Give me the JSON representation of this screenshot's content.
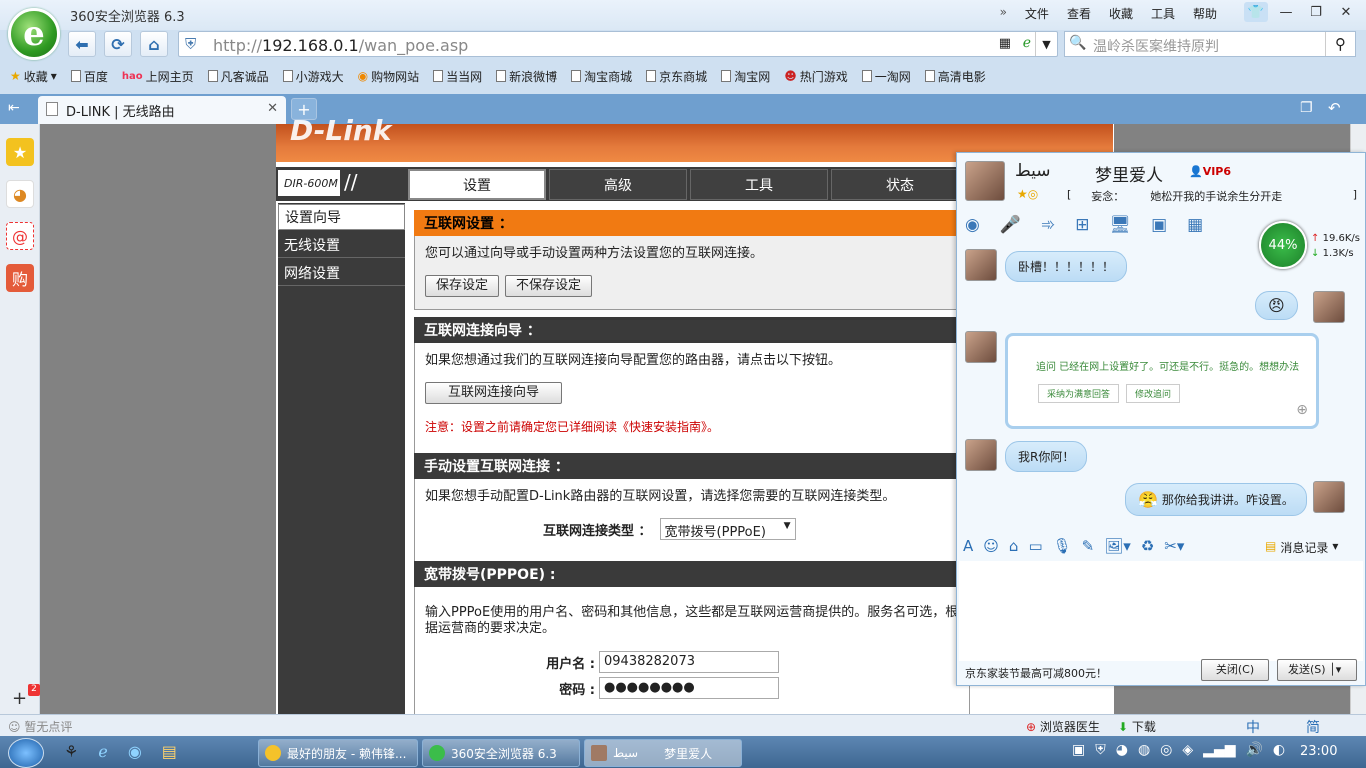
{
  "browser": {
    "title": "360安全浏览器 6.3",
    "menu": [
      "文件",
      "查看",
      "收藏",
      "工具",
      "帮助"
    ],
    "url_prefix": "http://",
    "url_host": "192.168.0.1",
    "url_path": "/wan_poe.asp",
    "search_placeholder": "温岭杀医案维持原判",
    "favorites_label": "收藏",
    "bookmarks": [
      "百度",
      "上网主页",
      "凡客诚品",
      "小游戏大",
      "购物网站",
      "当当网",
      "新浪微博",
      "淘宝商城",
      "京东商城",
      "淘宝网",
      "热门游戏",
      "一淘网",
      "高清电影"
    ],
    "tab_title": "D-LINK | 无线路由",
    "status_left": "暂无点评",
    "status_doctor": "浏览器医生",
    "status_download": "下载",
    "status_ime": "中",
    "status_ime2": "简"
  },
  "router": {
    "model": "DIR-600M",
    "tabs": [
      "设置",
      "高级",
      "工具",
      "状态"
    ],
    "left_menu": [
      "设置向导",
      "无线设置",
      "网络设置"
    ],
    "internet_settings": {
      "title": "互联网设置 ：",
      "desc": "您可以通过向导或手动设置两种方法设置您的互联网连接。",
      "save": "保存设定",
      "nosave": "不保存设定"
    },
    "wizard": {
      "title": "互联网连接向导 ：",
      "desc": "如果您想通过我们的互联网连接向导配置您的路由器，请点击以下按钮。",
      "button": "互联网连接向导",
      "note": "注意：设置之前请确定您已详细阅读《快速安装指南》。"
    },
    "manual": {
      "title": "手动设置互联网连接 ：",
      "desc": "如果您想手动配置D-Link路由器的互联网设置，请选择您需要的互联网连接类型。",
      "type_label": "互联网连接类型 ：",
      "type_value": "宽带拨号(PPPoE)"
    },
    "pppoe": {
      "title": "宽带拨号(PPPOE) :",
      "desc": "输入PPPoE使用的用户名、密码和其他信息，这些都是互联网运营商提供的。服务名可选，根据运营商的要求决定。",
      "user_label": "用户名 :",
      "user_value": "09438282073",
      "pass_label": "密码 :",
      "pass_value": "●●●●●●●●"
    }
  },
  "qq": {
    "name_arabic": "سيط",
    "name": "梦里爱人",
    "signature_prefix": "[",
    "signature_label": "妄念：",
    "signature": "她松开我的手说余生分开走",
    "signature_suffix": "]",
    "net_percent": "44%",
    "up_speed": "19.6K/s",
    "down_speed": "1.3K/s",
    "messages": [
      "卧槽！！！！！！",
      "追问  已经在网上设置好了。可还是不行。挺急的。想想办法",
      "我R你阿！",
      "那你给我讲讲。咋设置。"
    ],
    "card_btn1": "采纳为满意回答",
    "card_btn2": "修改追问",
    "history_label": "消息记录",
    "ad_text": "京东家装节最高可减800元！",
    "close_btn": "关闭(C)",
    "send_btn": "发送(S)"
  },
  "taskbar": {
    "tasks": [
      "最好的朋友 - 赖伟锋...",
      "360安全浏览器 6.3",
      "梦里爱人"
    ],
    "task_prefix3": "سيط",
    "clock": "23:00"
  }
}
